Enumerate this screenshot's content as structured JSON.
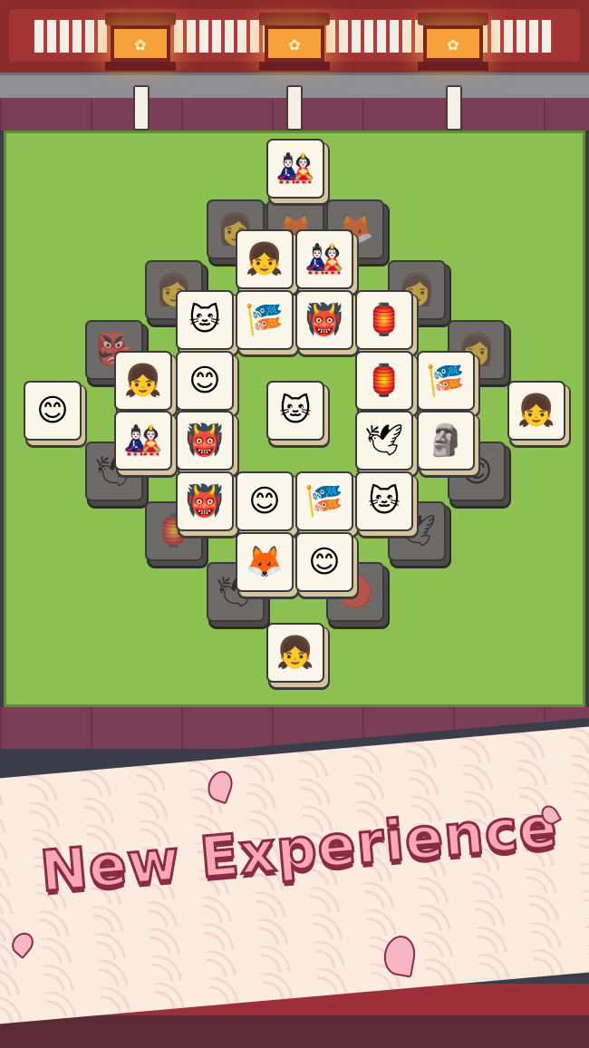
{
  "banner": {
    "headline": "New Experience"
  },
  "lanterns": [
    {
      "icon": "flower-icon"
    },
    {
      "icon": "flower-icon"
    },
    {
      "icon": "flower-icon"
    }
  ],
  "colors": {
    "board": "#8cc152",
    "beam": "#a23434",
    "headline": "#f9a8b4",
    "headline_outline": "#8a2b44"
  },
  "tiles": [
    {
      "icon": "daruma-icon",
      "active": true
    },
    {
      "icon": "kokeshi-doll-icon",
      "active": true
    },
    {
      "icon": "daruma-icon",
      "active": true
    },
    {
      "icon": "lucky-cat-icon",
      "active": true
    },
    {
      "icon": "koinobori-fish-icon",
      "active": true
    },
    {
      "icon": "tengu-mask-icon",
      "active": true
    },
    {
      "icon": "paper-lantern-icon",
      "active": true
    },
    {
      "icon": "okame-mask-icon",
      "active": true
    },
    {
      "icon": "kokeshi-doll-icon",
      "active": true
    },
    {
      "icon": "okame-mask-icon",
      "active": true
    },
    {
      "icon": "lucky-cat-icon",
      "active": true
    },
    {
      "icon": "paper-lantern-icon",
      "active": true
    },
    {
      "icon": "koinobori-fish-icon",
      "active": true
    },
    {
      "icon": "kokeshi-doll-icon",
      "active": true
    },
    {
      "icon": "daruma-icon",
      "active": true
    },
    {
      "icon": "tengu-mask-icon",
      "active": true
    },
    {
      "icon": "paper-crane-icon",
      "active": true
    },
    {
      "icon": "jizo-statue-icon",
      "active": true
    },
    {
      "icon": "tengu-mask-icon",
      "active": true
    },
    {
      "icon": "okame-mask-icon",
      "active": true
    },
    {
      "icon": "koinobori-fish-icon",
      "active": true
    },
    {
      "icon": "lucky-cat-icon",
      "active": true
    },
    {
      "icon": "kitsune-mask-icon",
      "active": true
    },
    {
      "icon": "okame-mask-icon",
      "active": true
    },
    {
      "icon": "kokeshi-doll-icon",
      "active": true
    }
  ]
}
